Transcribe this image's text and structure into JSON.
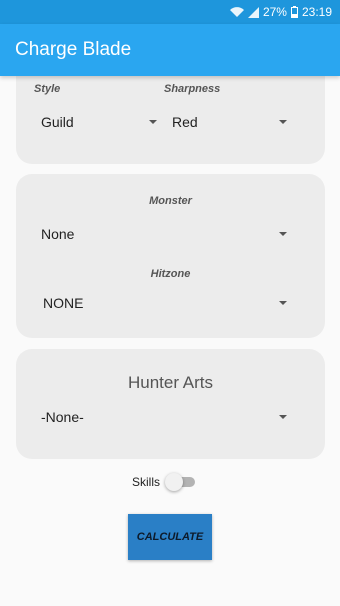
{
  "status_bar": {
    "battery": "27%",
    "time": "23:19",
    "icons": [
      "wifi-icon",
      "signal-icon",
      "battery-icon"
    ]
  },
  "app_bar": {
    "title": "Charge Blade"
  },
  "weapon_card": {
    "style_label": "Style",
    "style_value": "Guild",
    "sharpness_label": "Sharpness",
    "sharpness_value": "Red"
  },
  "monster_card": {
    "monster_label": "Monster",
    "monster_value": "None",
    "hitzone_label": "Hitzone",
    "hitzone_value": "NONE"
  },
  "arts_card": {
    "title": "Hunter Arts",
    "arts_value": "-None-"
  },
  "skills": {
    "label": "Skills",
    "enabled": false
  },
  "calculate_button": {
    "label": "CALCULATE"
  },
  "colors": {
    "app_bar": "#2aa6f0",
    "status_bar": "#1e96dc",
    "card": "#ececec",
    "button": "#2a7fc6"
  }
}
